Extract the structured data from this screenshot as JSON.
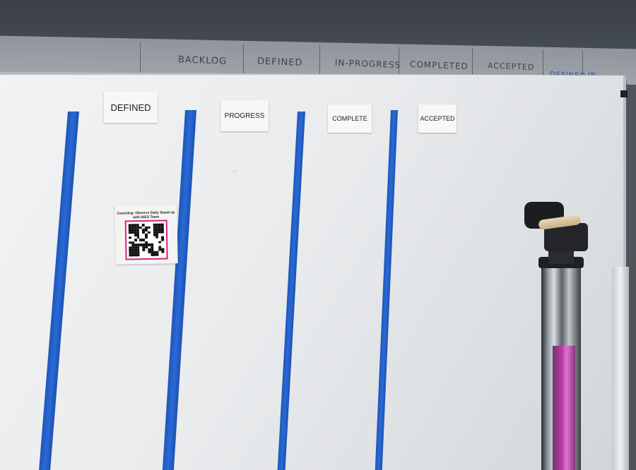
{
  "back_board": {
    "headings": [
      "BACKLOG",
      "DEFINED",
      "IN-PROGRESS",
      "COMPLETED",
      "ACCEPTED",
      "DEFINED",
      "IN-PROGRESS"
    ]
  },
  "labels": {
    "defined": "DEFINED",
    "progress": "PROGRESS",
    "complete": "COMPLETE",
    "accepted": "ACCEPTED"
  },
  "qr_card": {
    "title": "Coaching: Observe Daily Stand up with IAES Team",
    "frame_color": "#d3237f"
  },
  "colors": {
    "tape": "#2a6ad6",
    "whiteboard": "#ecedef",
    "pole_accent": "#c42fb3"
  }
}
